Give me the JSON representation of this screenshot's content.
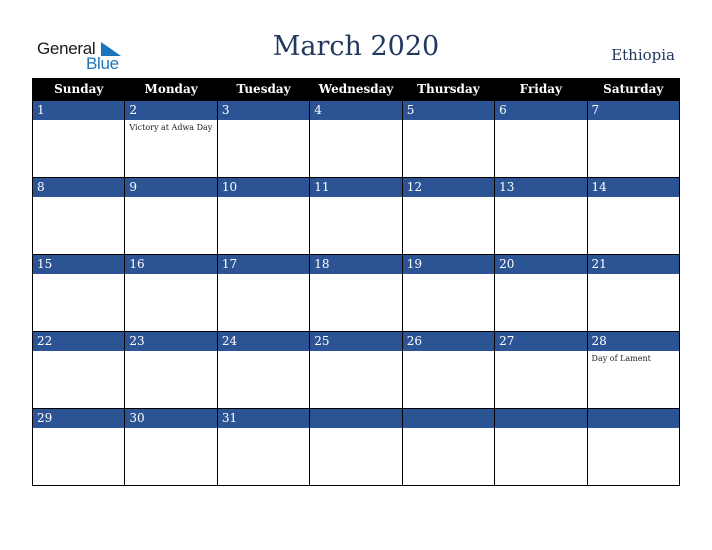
{
  "logo": {
    "word1": "General",
    "word2": "Blue",
    "accent_color": "#1b75bc"
  },
  "header": {
    "title": "March 2020",
    "country": "Ethiopia"
  },
  "colors": {
    "header_bg": "#000000",
    "day_bar": "#2c5494",
    "title": "#24385f"
  },
  "weekdays": [
    "Sunday",
    "Monday",
    "Tuesday",
    "Wednesday",
    "Thursday",
    "Friday",
    "Saturday"
  ],
  "weeks": [
    [
      {
        "day": "1",
        "event": ""
      },
      {
        "day": "2",
        "event": "Victory at Adwa Day"
      },
      {
        "day": "3",
        "event": ""
      },
      {
        "day": "4",
        "event": ""
      },
      {
        "day": "5",
        "event": ""
      },
      {
        "day": "6",
        "event": ""
      },
      {
        "day": "7",
        "event": ""
      }
    ],
    [
      {
        "day": "8",
        "event": ""
      },
      {
        "day": "9",
        "event": ""
      },
      {
        "day": "10",
        "event": ""
      },
      {
        "day": "11",
        "event": ""
      },
      {
        "day": "12",
        "event": ""
      },
      {
        "day": "13",
        "event": ""
      },
      {
        "day": "14",
        "event": ""
      }
    ],
    [
      {
        "day": "15",
        "event": ""
      },
      {
        "day": "16",
        "event": ""
      },
      {
        "day": "17",
        "event": ""
      },
      {
        "day": "18",
        "event": ""
      },
      {
        "day": "19",
        "event": ""
      },
      {
        "day": "20",
        "event": ""
      },
      {
        "day": "21",
        "event": ""
      }
    ],
    [
      {
        "day": "22",
        "event": ""
      },
      {
        "day": "23",
        "event": ""
      },
      {
        "day": "24",
        "event": ""
      },
      {
        "day": "25",
        "event": ""
      },
      {
        "day": "26",
        "event": ""
      },
      {
        "day": "27",
        "event": ""
      },
      {
        "day": "28",
        "event": "Day of Lament"
      }
    ],
    [
      {
        "day": "29",
        "event": ""
      },
      {
        "day": "30",
        "event": ""
      },
      {
        "day": "31",
        "event": ""
      },
      {
        "day": "",
        "event": ""
      },
      {
        "day": "",
        "event": ""
      },
      {
        "day": "",
        "event": ""
      },
      {
        "day": "",
        "event": ""
      }
    ]
  ]
}
